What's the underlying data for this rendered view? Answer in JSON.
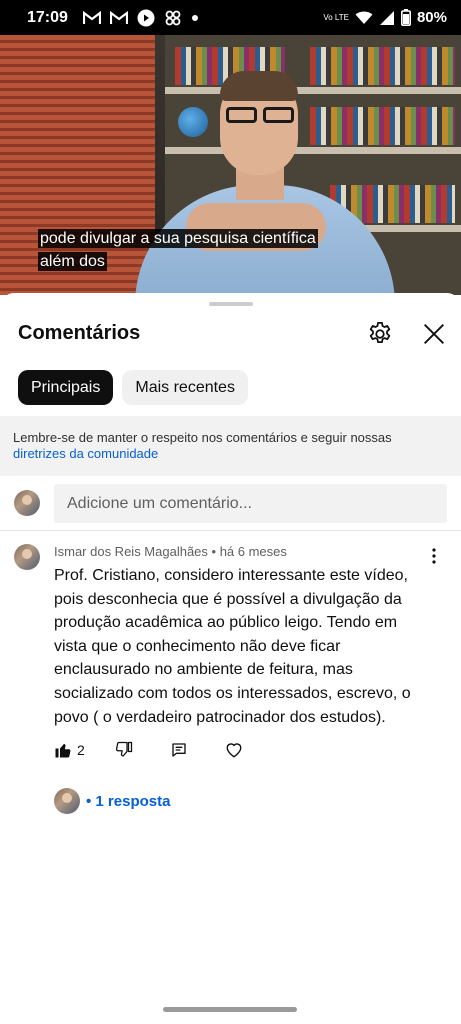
{
  "status_bar": {
    "time": "17:09",
    "network": "Vo LTE",
    "battery": "80%",
    "icons": [
      "gmail-icon",
      "gmail-icon",
      "youtube-icon",
      "pinwheel-icon",
      "dot-icon",
      "wifi-icon",
      "signal-icon",
      "battery-icon"
    ]
  },
  "video": {
    "caption_line1": "pode divulgar a sua pesquisa científica",
    "caption_line2": "além dos"
  },
  "comments_sheet": {
    "title": "Comentários",
    "chips": [
      {
        "label": "Principais",
        "active": true
      },
      {
        "label": "Mais recentes",
        "active": false
      }
    ],
    "notice_text": "Lembre-se de manter o respeito nos comentários e seguir nossas",
    "notice_link": "diretrizes da comunidade",
    "add_comment_placeholder": "Adicione um comentário..."
  },
  "comment": {
    "author": "Ismar dos Reis Magalhães",
    "separator": " • ",
    "time": "há 6 meses",
    "text": "Prof. Cristiano, considero interessante este vídeo, pois desconhecia que é possível a divulgação da produção acadêmica ao público leigo. Tendo em vista que o conhecimento não deve ficar enclausurado no ambiente de feitura, mas socializado com todos os interessados, escrevo, o povo ( o verdadeiro patrocinador dos estudos).",
    "like_count": "2",
    "replies_label": "• 1 resposta"
  },
  "colors": {
    "link": "#065fd4",
    "chip_active_bg": "#0f0f0f",
    "chip_inactive_bg": "#f0f0f0",
    "notice_bg": "#f2f2f2"
  }
}
